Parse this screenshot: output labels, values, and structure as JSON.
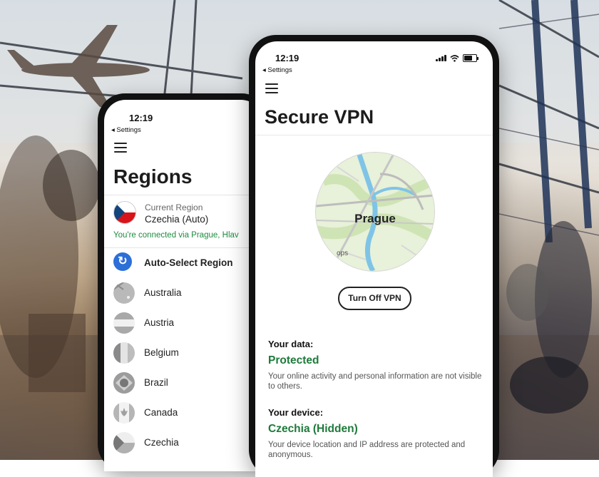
{
  "back_phone": {
    "status_time": "12:19",
    "back_link": "◂ Settings",
    "title": "Regions",
    "current_region": {
      "caption": "Current Region",
      "value": "Czechia (Auto)",
      "connected": "You're connected via Prague, Hlav"
    },
    "regions": [
      {
        "label": "Auto-Select Region",
        "icon": "refresh-icon"
      },
      {
        "label": "Australia",
        "icon": "flag-australia-icon"
      },
      {
        "label": "Austria",
        "icon": "flag-austria-icon"
      },
      {
        "label": "Belgium",
        "icon": "flag-belgium-icon"
      },
      {
        "label": "Brazil",
        "icon": "flag-brazil-icon"
      },
      {
        "label": "Canada",
        "icon": "flag-canada-icon"
      },
      {
        "label": "Czechia",
        "icon": "flag-czechia-icon"
      }
    ]
  },
  "front_phone": {
    "status_time": "12:19",
    "back_link": "◂ Settings",
    "title": "Secure VPN",
    "map": {
      "city": "Prague",
      "sub_label": "ops"
    },
    "button_label": "Turn Off VPN",
    "data_section": {
      "label": "Your data:",
      "status": "Protected",
      "description": "Your online activity and personal information are not visible to others."
    },
    "device_section": {
      "label": "Your device:",
      "status": "Czechia (Hidden)",
      "description": "Your device location and IP address are protected and anonymous."
    }
  },
  "colors": {
    "accent_green": "#1e7a3a",
    "link_green": "#1e8c3e",
    "auto_blue": "#2d6fd8"
  }
}
